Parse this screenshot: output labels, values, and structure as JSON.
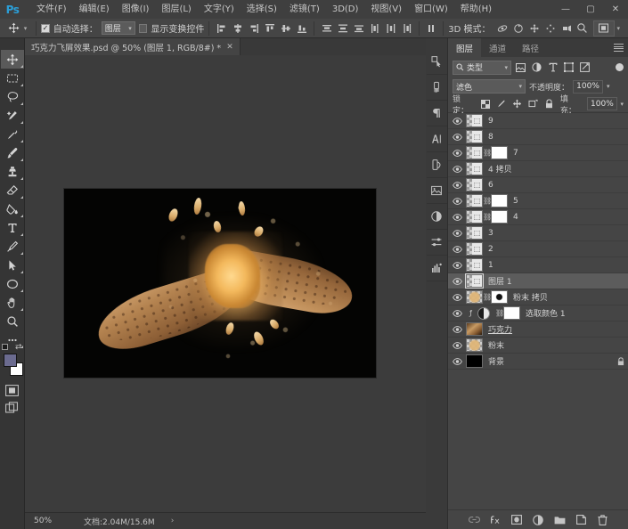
{
  "app": {
    "logo": "Ps"
  },
  "titlebar": {
    "menus": [
      "文件(F)",
      "编辑(E)",
      "图像(I)",
      "图层(L)",
      "文字(Y)",
      "选择(S)",
      "滤镜(T)",
      "3D(D)",
      "视图(V)",
      "窗口(W)",
      "帮助(H)"
    ],
    "window_controls": {
      "minimize": "—",
      "maximize": "▢",
      "close": "✕"
    }
  },
  "options_bar": {
    "tool_icon": "move-tool-icon",
    "auto_select_label": "自动选择：",
    "auto_select_checked": "✓",
    "auto_select_value": "图层",
    "show_transform_label": "显示变换控件",
    "show_transform_checked": "",
    "mode_3d_label": "3D 模式：",
    "search_icon": "search-icon",
    "workspace_icon": "workspace-icon"
  },
  "document_tab": {
    "label": "巧克力飞屑效果.psd @ 50% (图层 1, RGB/8#) *",
    "close": "✕"
  },
  "status_bar": {
    "zoom": "50%",
    "doc_size": "文档:2.04M/15.6M",
    "arrow": "›"
  },
  "toolbar": {
    "tools": [
      {
        "name": "move-tool",
        "active": true
      },
      {
        "name": "marquee-tool",
        "active": false
      },
      {
        "name": "lasso-tool",
        "active": false
      },
      {
        "name": "quick-selection-tool",
        "active": false
      },
      {
        "name": "eyedropper-tool",
        "active": false
      },
      {
        "name": "brush-tool",
        "active": false
      },
      {
        "name": "clone-stamp-tool",
        "active": false
      },
      {
        "name": "eraser-tool",
        "active": false
      },
      {
        "name": "paint-bucket-tool",
        "active": false
      },
      {
        "name": "type-tool",
        "active": false
      },
      {
        "name": "pen-tool",
        "active": false
      },
      {
        "name": "path-selection-tool",
        "active": false
      },
      {
        "name": "shape-tool",
        "active": false
      },
      {
        "name": "hand-tool",
        "active": false
      },
      {
        "name": "zoom-tool",
        "active": false
      },
      {
        "name": "more-tools",
        "active": false
      }
    ],
    "foreground_color": "#6b6b8f",
    "background_color": "#ffffff"
  },
  "right_rail": {
    "icons": [
      "3d-select-icon",
      "brush-settings-icon",
      "paragraph-icon",
      "character-icon",
      "color-icon",
      "library-icon",
      "adjustments-icon",
      "properties-icon",
      "histogram-icon"
    ]
  },
  "layers_panel": {
    "tabs": [
      {
        "label": "图层",
        "active": true
      },
      {
        "label": "通道",
        "active": false
      },
      {
        "label": "路径",
        "active": false
      }
    ],
    "filter": {
      "kind_label": "类型",
      "search_icon": "search-icon",
      "icons": [
        "pixel-filter-icon",
        "adjustment-filter-icon",
        "type-filter-icon",
        "shape-filter-icon",
        "smartobject-filter-icon"
      ],
      "toggle": "filter-toggle"
    },
    "blend_mode": "滤色",
    "opacity_label": "不透明度：",
    "opacity_value": "100%",
    "lock_label": "锁定：",
    "lock_icons": [
      "lock-transparent-icon",
      "lock-image-icon",
      "lock-position-icon",
      "lock-artboard-icon",
      "lock-all-icon"
    ],
    "fill_label": "填充：",
    "fill_value": "100%",
    "layers": [
      {
        "name": "9",
        "visible": true,
        "kind": "smart",
        "mask": false,
        "selected": false
      },
      {
        "name": "8",
        "visible": true,
        "kind": "smart",
        "mask": false,
        "selected": false
      },
      {
        "name": "7",
        "visible": true,
        "kind": "smart",
        "mask": "white",
        "selected": false
      },
      {
        "name": "4 拷贝",
        "visible": true,
        "kind": "smart",
        "mask": false,
        "selected": false
      },
      {
        "name": "6",
        "visible": true,
        "kind": "smart",
        "mask": false,
        "selected": false
      },
      {
        "name": "5",
        "visible": true,
        "kind": "smart",
        "mask": "white",
        "selected": false
      },
      {
        "name": "4",
        "visible": true,
        "kind": "smart",
        "mask": "white",
        "selected": false
      },
      {
        "name": "3",
        "visible": true,
        "kind": "smart",
        "mask": false,
        "selected": false
      },
      {
        "name": "2",
        "visible": true,
        "kind": "smart",
        "mask": false,
        "selected": false
      },
      {
        "name": "1",
        "visible": true,
        "kind": "smart",
        "mask": false,
        "selected": false
      },
      {
        "name": "图层 1",
        "visible": true,
        "kind": "smart",
        "mask": false,
        "selected": true
      },
      {
        "name": "粉末 拷贝",
        "visible": true,
        "kind": "powder",
        "mask": "spot",
        "selected": false
      },
      {
        "name": "选取颜色 1",
        "visible": true,
        "kind": "adjustment",
        "mask": "white",
        "selected": false
      },
      {
        "name": "巧克力",
        "visible": true,
        "kind": "choco",
        "mask": false,
        "selected": false,
        "underline": true
      },
      {
        "name": "粉末",
        "visible": true,
        "kind": "powder",
        "mask": false,
        "selected": false
      },
      {
        "name": "背景",
        "visible": true,
        "kind": "black",
        "mask": false,
        "selected": false,
        "locked": true
      }
    ],
    "footer_icons": [
      "link-layers-icon",
      "layer-style-fx-icon",
      "add-mask-icon",
      "adjustment-layer-icon",
      "new-group-icon",
      "new-layer-icon",
      "delete-layer-icon"
    ]
  },
  "canvas": {
    "artwork_description": "巧克力飞屑效果",
    "background_color": "#040403"
  }
}
